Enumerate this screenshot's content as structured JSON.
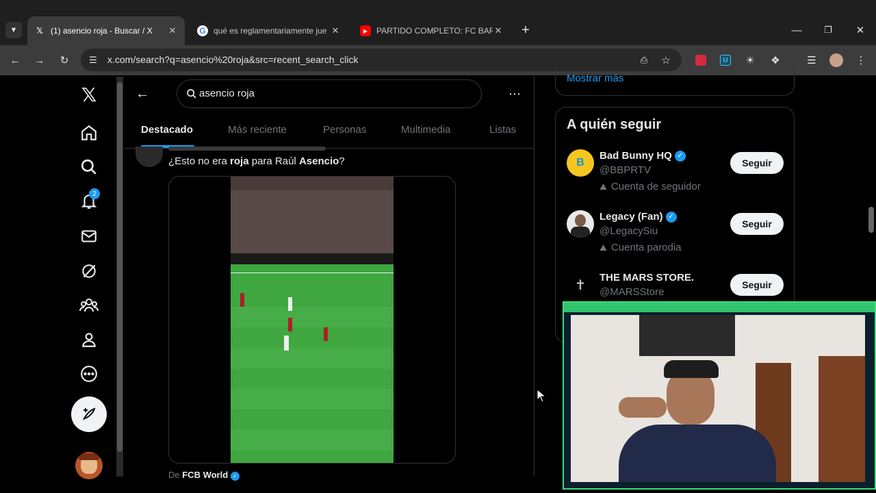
{
  "browser": {
    "tabs": [
      {
        "title": "(1) asencio roja - Buscar / X",
        "icon": "x-logo-icon",
        "close": "✕"
      },
      {
        "title": "qué es reglamentariamente jue",
        "icon": "google-g-icon",
        "close": "✕"
      },
      {
        "title": "PARTIDO COMPLETO: FC BARCE",
        "icon": "youtube-icon",
        "close": "✕"
      }
    ],
    "new_tab": "+",
    "url": "x.com/search?q=asencio%20roja&src=recent_search_click"
  },
  "x": {
    "notifications_badge": "2",
    "search_value": "asencio roja",
    "tabs": [
      "Destacado",
      "Más reciente",
      "Personas",
      "Multimedia",
      "Listas"
    ],
    "tweet": {
      "text_prefix": "¿Esto no era ",
      "text_bold1": "roja",
      "text_mid": " para Raúl ",
      "text_bold2": "Asencio",
      "text_suffix": "?",
      "source_prefix": "De ",
      "source_name": "FCB World"
    },
    "right": {
      "show_more": "Mostrar más",
      "who_to_follow": "A quién seguir",
      "follow_label": "Seguir",
      "accounts": [
        {
          "name": "Bad Bunny HQ",
          "handle": "@BBPRTV",
          "note": "Cuenta de seguidor",
          "verified": true
        },
        {
          "name": "Legacy (Fan)",
          "handle": "@LegacySiu",
          "note": "Cuenta parodia",
          "verified": true
        },
        {
          "name": "THE MARS STORE.",
          "handle": "@MARSStore",
          "note": "",
          "verified": false
        }
      ]
    }
  },
  "colors": {
    "accent": "#1d9bf0",
    "webcam_border": "#39e07a"
  }
}
